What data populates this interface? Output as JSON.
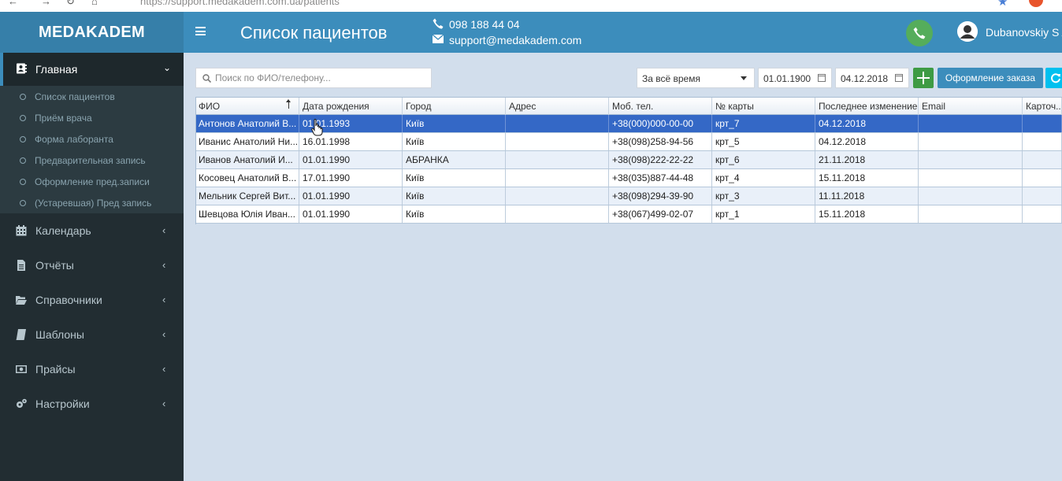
{
  "browser": {
    "url": "https://support.medakadem.com.ua/patients"
  },
  "sidebar": {
    "logo": "MEDAKADEM",
    "main": {
      "label": "Главная",
      "icon": "address-book-icon"
    },
    "submenu": [
      "Список пациентов",
      "Приём врача",
      "Форма лаборанта",
      "Предварительная запись",
      "Оформление пред.записи",
      "(Устаревшая) Пред запись"
    ],
    "items": [
      {
        "label": "Календарь",
        "icon": "calendar-icon"
      },
      {
        "label": "Отчёты",
        "icon": "file-icon"
      },
      {
        "label": "Справочники",
        "icon": "folder-open-icon"
      },
      {
        "label": "Шаблоны",
        "icon": "book-icon"
      },
      {
        "label": "Прайсы",
        "icon": "money-icon"
      },
      {
        "label": "Настройки",
        "icon": "gears-icon"
      }
    ]
  },
  "header": {
    "title": "Список пациентов",
    "phone": "098 188 44 04",
    "email": "support@medakadem.com",
    "user": "Dubanovskiy S A"
  },
  "toolbar": {
    "search_placeholder": "Поиск по ФИО/телефону...",
    "period": "За всё время",
    "date_from": "01.01.1900",
    "date_to": "04.12.2018",
    "order_button": "Оформление заказа"
  },
  "table": {
    "columns": [
      "ФИО",
      "Дата рождения",
      "Город",
      "Адрес",
      "Моб. тел.",
      "№ карты",
      "Последнее изменение",
      "Email",
      "Карточ..."
    ],
    "rows": [
      [
        "Антонов Анатолий В...",
        "01.01.1993",
        "Київ",
        "",
        "+38(000)000-00-00",
        "крт_7",
        "04.12.2018",
        "",
        ""
      ],
      [
        "Иванис Анатолий Ни...",
        "16.01.1998",
        "Київ",
        "",
        "+38(098)258-94-56",
        "крт_5",
        "04.12.2018",
        "",
        ""
      ],
      [
        "Иванов Анатолий И...",
        "01.01.1990",
        "АБРАНКА",
        "",
        "+38(098)222-22-22",
        "крт_6",
        "21.11.2018",
        "",
        ""
      ],
      [
        "Косовец Анатолий В...",
        "17.01.1990",
        "Київ",
        "",
        "+38(035)887-44-48",
        "крт_4",
        "15.11.2018",
        "",
        ""
      ],
      [
        "Мельник Сергей Вит...",
        "01.01.1990",
        "Київ",
        "",
        "+38(098)294-39-90",
        "крт_3",
        "11.11.2018",
        "",
        ""
      ],
      [
        "Шевцова Юлія Иван...",
        "01.01.1990",
        "Київ",
        "",
        "+38(067)499-02-07",
        "крт_1",
        "15.11.2018",
        "",
        ""
      ]
    ],
    "selected_row": 0
  },
  "colors": {
    "header": "#3c8dbc",
    "logo_bg": "#367fa9",
    "sidebar": "#222d32",
    "content_bg": "#d2deec",
    "selected_row": "#3468c6",
    "add_button": "#3e9b44",
    "call_button": "#55ad5b"
  }
}
